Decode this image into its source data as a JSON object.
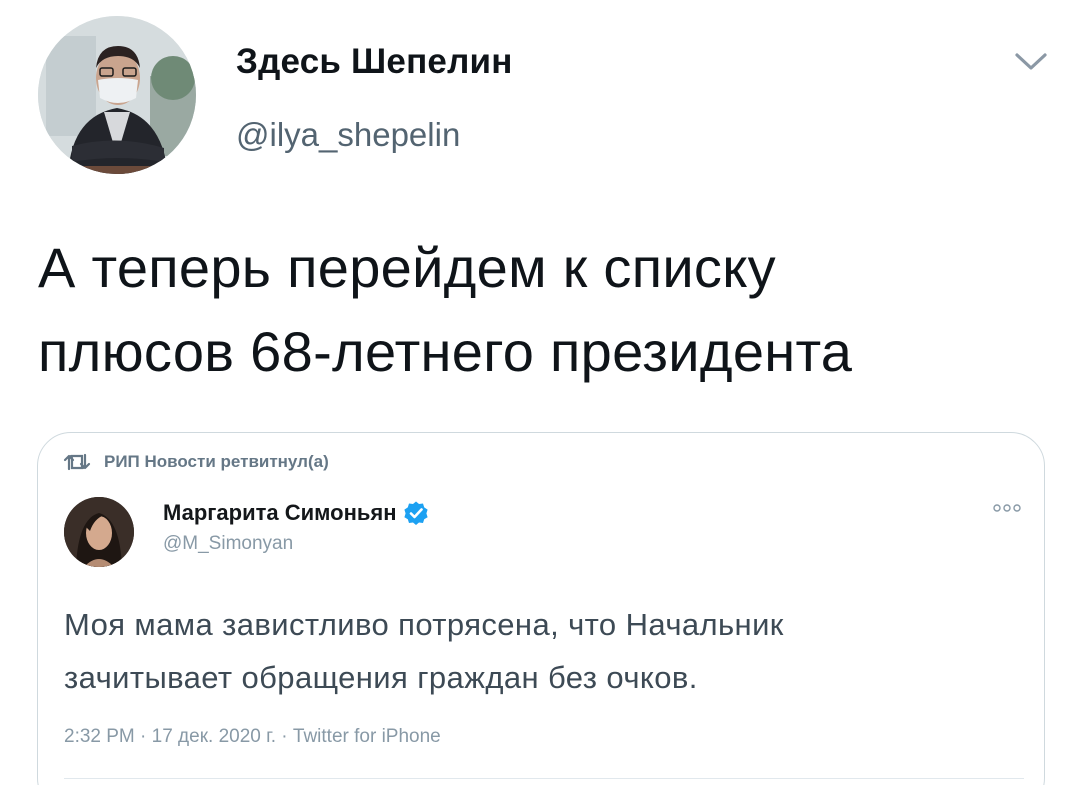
{
  "tweet": {
    "author_name": "Здесь Шепелин",
    "author_handle": "@ilya_shepelin",
    "text_line1": "А теперь перейдем к списку",
    "text_line2": "плюсов 68-летнего президента",
    "menu_icon": "chevron-down-icon"
  },
  "quoted": {
    "retweet_label": "РИП Новости ретвитнул(а)",
    "author_name": "Маргарита Симоньян",
    "author_handle": "@M_Simonyan",
    "verified": true,
    "text_line1": "Моя мама завистливо потрясена, что Начальник",
    "text_line2": "зачитывает обращения граждан без очков.",
    "meta": "2:32 PM · 17 дек. 2020 г. · Twitter for iPhone",
    "more_icon": "more-dots-icon"
  },
  "colors": {
    "text_primary": "#0f1419",
    "text_secondary": "#536471",
    "border": "#cfd9de",
    "verified_blue": "#1da1f2"
  }
}
